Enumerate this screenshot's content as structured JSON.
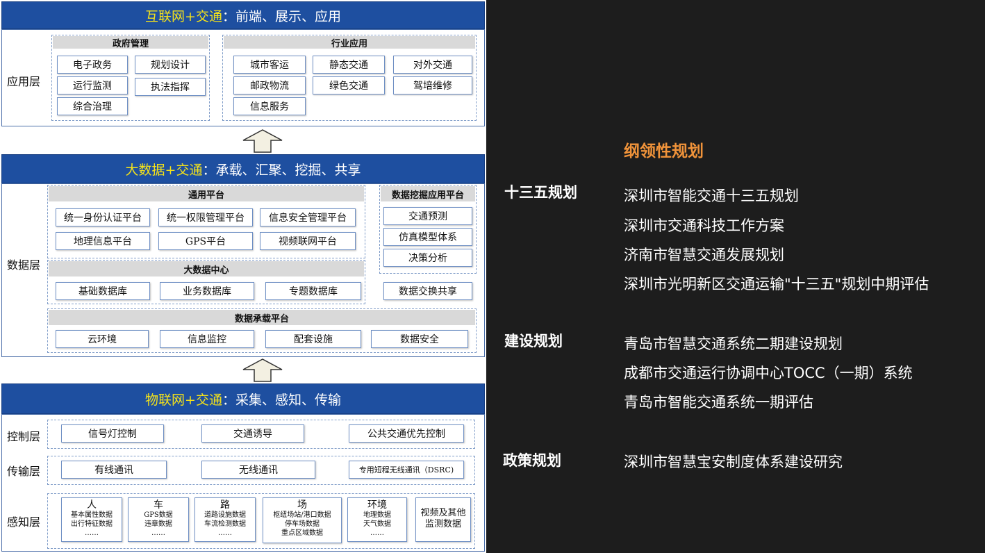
{
  "internet": {
    "title_hl": "互联网+交通",
    "title_rest": "：前端、展示、应用",
    "layer_label": "应用层",
    "gov": {
      "header": "政府管理",
      "items": [
        "电子政务",
        "规划设计",
        "运行监测",
        "执法指挥",
        "综合治理"
      ]
    },
    "industry": {
      "header": "行业应用",
      "items": [
        "城市客运",
        "静态交通",
        "对外交通",
        "邮政物流",
        "绿色交通",
        "驾培维修",
        "信息服务"
      ]
    }
  },
  "bigdata": {
    "title_hl": "大数据+交通",
    "title_rest": "：承载、汇聚、挖掘、共享",
    "layer_label": "数据层",
    "common": {
      "header": "通用平台",
      "items": [
        "统一身份认证平台",
        "统一权限管理平台",
        "信息安全管理平台",
        "地理信息平台",
        "GPS平台",
        "视频联网平台"
      ]
    },
    "mining": {
      "header": "数据挖掘应用平台",
      "items": [
        "交通预测",
        "仿真模型体系",
        "决策分析"
      ]
    },
    "center": {
      "header": "大数据中心",
      "items": [
        "基础数据库",
        "业务数据库",
        "专题数据库"
      ]
    },
    "exchange": "数据交换共享",
    "carrier": {
      "header": "数据承载平台",
      "items": [
        "云环境",
        "信息监控",
        "配套设施",
        "数据安全"
      ]
    }
  },
  "iot": {
    "title_hl": "物联网+交通",
    "title_rest": "：采集、感知、传输",
    "control": {
      "label": "控制层",
      "items": [
        "信号灯控制",
        "交通诱导",
        "公共交通优先控制"
      ]
    },
    "transport": {
      "label": "传输层",
      "items": [
        "有线通讯",
        "无线通讯",
        "专用短程无线通讯（DSRC)"
      ]
    },
    "sense": {
      "label": "感知层",
      "cols": [
        {
          "t": "人",
          "l1": "基本属性数据",
          "l2": "出行特征数据",
          "l3": "……"
        },
        {
          "t": "车",
          "l1": "GPS数据",
          "l2": "违章数据",
          "l3": "……"
        },
        {
          "t": "路",
          "l1": "道路设施数据",
          "l2": "车流检测数据",
          "l3": "……"
        },
        {
          "t": "场",
          "l1": "枢纽场站/港口数据",
          "l2": "停车场数据",
          "l3": "重点区域数据"
        },
        {
          "t": "环境",
          "l1": "地理数据",
          "l2": "天气数据",
          "l3": "……"
        },
        {
          "t": "视频及其他",
          "l1": "监测数据",
          "l2": "",
          "l3": ""
        }
      ]
    }
  },
  "side": {
    "heading": "纲领性规划",
    "sections": [
      {
        "cat": "十三五规划",
        "items": [
          "深圳市智能交通十三五规划",
          "深圳市交通科技工作方案",
          "济南市智慧交通发展规划",
          "深圳市光明新区交通运输\"十三五\"规划中期评估"
        ]
      },
      {
        "cat": "建设规划",
        "items": [
          "青岛市智慧交通系统二期建设规划",
          "成都市交通运行协调中心TOCC（一期）系统",
          "青岛市智能交通系统一期评估"
        ]
      },
      {
        "cat": "政策规划",
        "items": [
          "深圳市智慧宝安制度体系建设研究"
        ]
      }
    ]
  },
  "colors": {
    "band": "#1e4fa0",
    "highlight": "#f4e21a",
    "heading": "#f0933a",
    "background": "#1d1d1d"
  }
}
